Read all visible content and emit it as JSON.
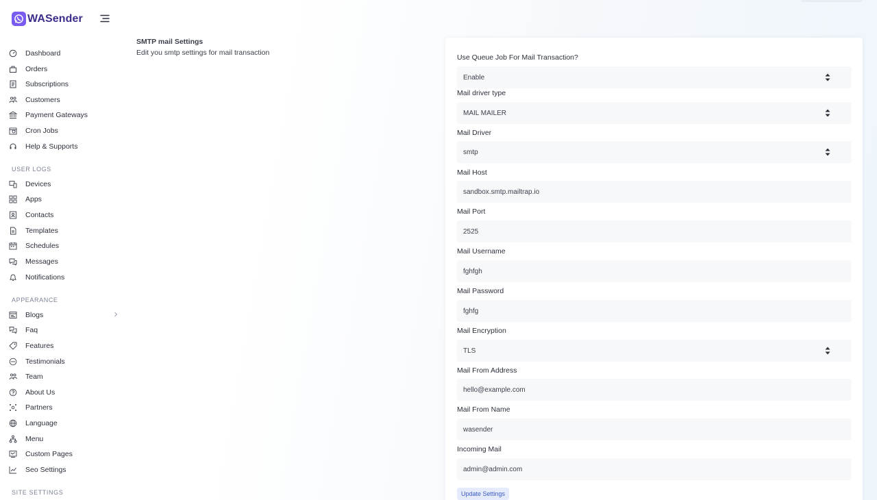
{
  "app": {
    "brand": "WASender"
  },
  "sidebar": {
    "items": [
      {
        "label": "Dashboard",
        "icon": "dashboard-icon"
      },
      {
        "label": "Orders",
        "icon": "orders-icon"
      },
      {
        "label": "Subscriptions",
        "icon": "subscriptions-icon"
      },
      {
        "label": "Customers",
        "icon": "customers-icon"
      },
      {
        "label": "Payment Gateways",
        "icon": "bank-icon"
      },
      {
        "label": "Cron Jobs",
        "icon": "cron-icon"
      },
      {
        "label": "Help & Supports",
        "icon": "headset-icon"
      }
    ],
    "user_logs_label": "USER LOGS",
    "user_logs": [
      {
        "label": "Devices",
        "icon": "devices-icon"
      },
      {
        "label": "Apps",
        "icon": "apps-icon"
      },
      {
        "label": "Contacts",
        "icon": "contacts-icon"
      },
      {
        "label": "Templates",
        "icon": "templates-icon"
      },
      {
        "label": "Schedules",
        "icon": "calendar-icon"
      },
      {
        "label": "Messages",
        "icon": "messages-icon"
      },
      {
        "label": "Notifications",
        "icon": "notifications-icon"
      }
    ],
    "appearance_label": "APPEARANCE",
    "appearance": [
      {
        "label": "Blogs",
        "icon": "blogs-icon"
      },
      {
        "label": "Faq",
        "icon": "faq-icon"
      },
      {
        "label": "Features",
        "icon": "features-icon"
      },
      {
        "label": "Testimonials",
        "icon": "testimonials-icon"
      },
      {
        "label": "Team",
        "icon": "team-icon"
      },
      {
        "label": "About Us",
        "icon": "about-icon"
      },
      {
        "label": "Partners",
        "icon": "partners-icon"
      },
      {
        "label": "Language",
        "icon": "globe-icon"
      },
      {
        "label": "Menu",
        "icon": "menu-tree-icon"
      },
      {
        "label": "Custom Pages",
        "icon": "pages-icon"
      },
      {
        "label": "Seo Settings",
        "icon": "seo-icon"
      }
    ],
    "site_settings_label": "SITE SETTINGS"
  },
  "section": {
    "title": "SMTP mail Settings",
    "subtitle": "Edit you smtp settings for mail transaction"
  },
  "form": {
    "queue_label": "Use Queue Job For Mail Transaction?",
    "queue_value": "Enable",
    "driver_type_label": "Mail driver type",
    "driver_type_value": "MAIL MAILER",
    "driver_label": "Mail Driver",
    "driver_value": "smtp",
    "host_label": "Mail Host",
    "host_value": "sandbox.smtp.mailtrap.io",
    "port_label": "Mail Port",
    "port_value": "2525",
    "username_label": "Mail Username",
    "username_value": "fghfgh",
    "password_label": "Mail Password",
    "password_value": "fghfg",
    "encryption_label": "Mail Encryption",
    "encryption_value": "TLS",
    "from_address_label": "Mail From Address",
    "from_address_value": "hello@example.com",
    "from_name_label": "Mail From Name",
    "from_name_value": "wasender",
    "incoming_label": "Incoming Mail",
    "incoming_value": "admin@admin.com",
    "submit_label": "Update Settings"
  },
  "colors": {
    "brand": "#7a5cf0",
    "button_bg": "#e5ebfb",
    "button_text": "#3b5bc4"
  }
}
